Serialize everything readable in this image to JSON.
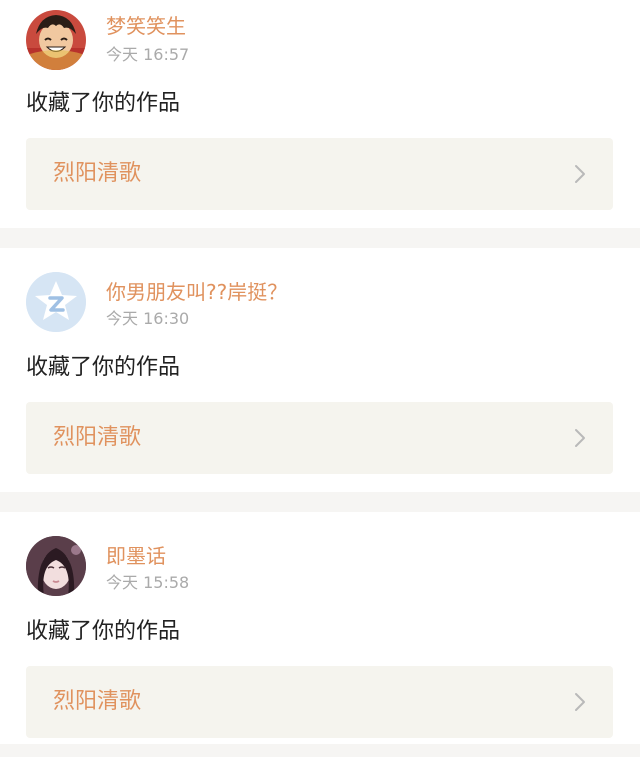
{
  "notifications": [
    {
      "username": "梦笑笑生",
      "time": "今天 16:57",
      "action": "收藏了你的作品",
      "work_title": "烈阳清歌",
      "avatar_icon": "anime-character-avatar",
      "arrow_icon": "chevron-right-icon"
    },
    {
      "username": "你男朋友叫??岸挺？",
      "time": "今天 16:30",
      "action": "收藏了你的作品",
      "work_title": "烈阳清歌",
      "avatar_icon": "default-qq-avatar",
      "arrow_icon": "chevron-right-icon"
    },
    {
      "username": "即墨话",
      "time": "今天 15:58",
      "action": "收藏了你的作品",
      "work_title": "烈阳清歌",
      "avatar_icon": "portrait-photo-avatar",
      "arrow_icon": "chevron-right-icon"
    }
  ],
  "colors": {
    "accent": "#e0925e",
    "link_background": "#f5f4ee",
    "separator": "#f6f5f3",
    "text": "#222222",
    "muted": "#aaaaaa"
  }
}
